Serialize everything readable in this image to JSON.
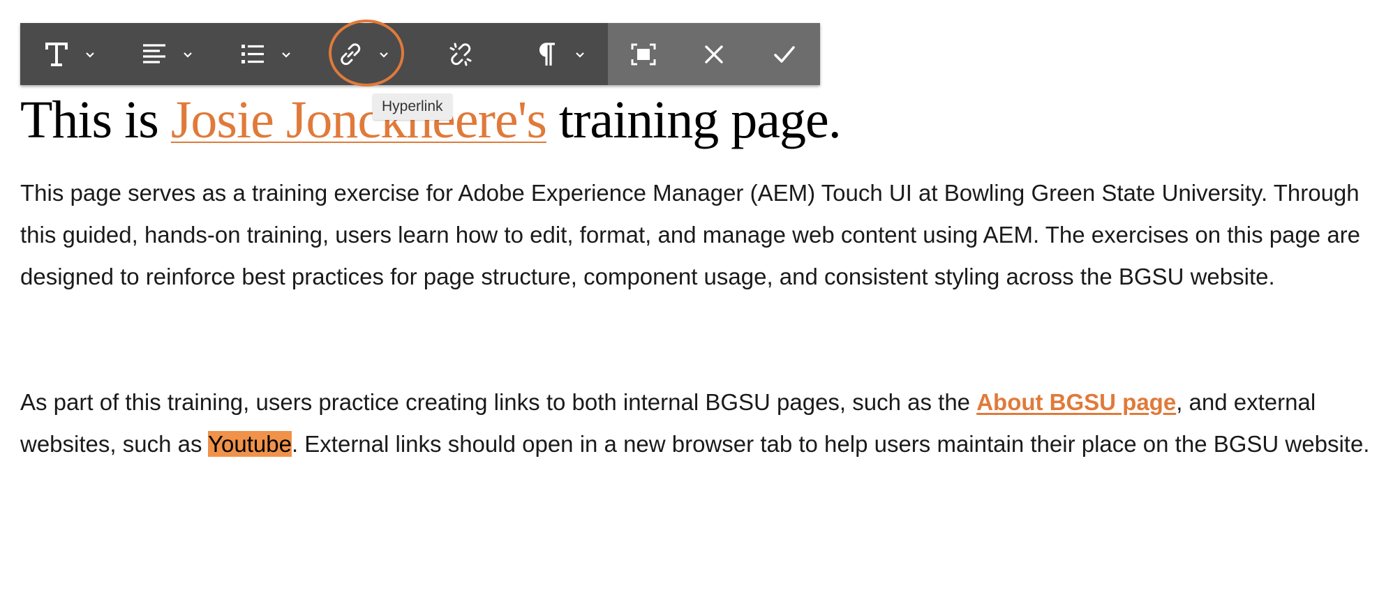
{
  "toolbar": {
    "buttons": [
      {
        "name": "text-format",
        "icon": "text-format-icon",
        "tooltip": "",
        "has_dropdown": true
      },
      {
        "name": "justify",
        "icon": "align-left-icon",
        "tooltip": "",
        "has_dropdown": true
      },
      {
        "name": "lists",
        "icon": "bulleted-list-icon",
        "tooltip": "",
        "has_dropdown": true
      },
      {
        "name": "hyperlink",
        "icon": "link-icon",
        "tooltip": "Hyperlink",
        "has_dropdown": true
      },
      {
        "name": "unlink",
        "icon": "unlink-icon",
        "tooltip": "",
        "has_dropdown": false
      },
      {
        "name": "paragraph-format",
        "icon": "pilcrow-icon",
        "tooltip": "",
        "has_dropdown": true
      }
    ],
    "side_buttons": [
      {
        "name": "fullscreen",
        "icon": "fullscreen-icon"
      },
      {
        "name": "cancel",
        "icon": "close-icon"
      },
      {
        "name": "confirm",
        "icon": "checkmark-icon"
      }
    ],
    "tooltip_text": "Hyperlink",
    "highlight_color": "#e07a3a",
    "background": "#4b4b4b",
    "side_background": "#6d6d6d"
  },
  "heading": {
    "prefix": "This is ",
    "link_text": "Josie Jonckheere's",
    "suffix": " training page."
  },
  "paragraph1": "This page serves as a training exercise for Adobe Experience Manager (AEM) Touch UI at Bowling Green State University. Through this guided, hands-on training, users learn how to edit, format, and manage web content using AEM. The exercises on this page are designed to reinforce best practices for page structure, component usage, and consistent styling across the BGSU website.",
  "paragraph2": {
    "part1": "As part of this training, users practice creating links to both internal BGSU pages, such as the ",
    "link": "About BGSU page",
    "part2": ", and external websites, such as ",
    "selected": "Youtube",
    "part3": ". External links should open in a new browser tab to help users maintain their place on the BGSU website."
  },
  "colors": {
    "accent": "#e07a3a",
    "selection": "#f0924a",
    "text": "#1a1a1a"
  }
}
